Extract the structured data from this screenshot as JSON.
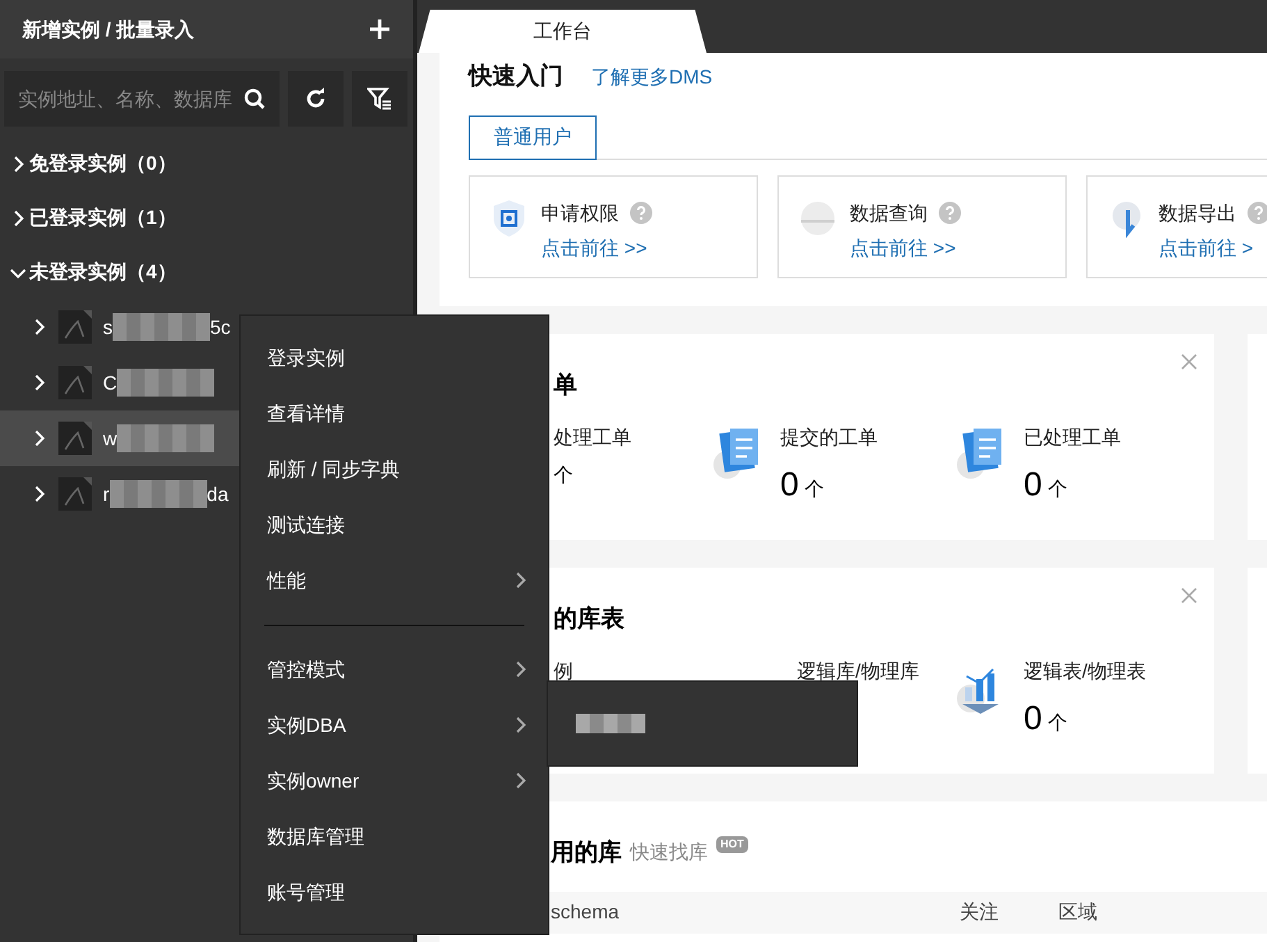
{
  "sidebar": {
    "title": "新增实例 / 批量录入",
    "search": {
      "placeholder": "实例地址、名称、数据库"
    },
    "groups": [
      {
        "label": "免登录实例（0）",
        "expanded": false
      },
      {
        "label": "已登录实例（1）",
        "expanded": false
      },
      {
        "label": "未登录实例（4）",
        "expanded": true,
        "items": [
          {
            "name_start": "s",
            "name_end": "5c",
            "selected": false
          },
          {
            "name_start": "C",
            "selected": false
          },
          {
            "name_start": "w",
            "selected": true
          },
          {
            "name_start": "r",
            "name_end": "da",
            "selected": false
          }
        ]
      }
    ]
  },
  "tabs": [
    {
      "label": "工作台",
      "selected": true
    }
  ],
  "quick_start": {
    "title": "快速入门",
    "link": "了解更多DMS",
    "role_tab": "普通用户",
    "entries": [
      {
        "label": "申请权限",
        "link": "点击前往 >>"
      },
      {
        "label": "数据查询",
        "link": "点击前往 >>"
      },
      {
        "label": "数据导出",
        "link": "点击前往 >"
      }
    ]
  },
  "cards": [
    {
      "title": "单",
      "stats": [
        {
          "label": "处理工单",
          "unit": "个",
          "icon": false
        },
        {
          "label": "提交的工单",
          "count": "0",
          "unit": "个",
          "icon": true
        },
        {
          "label": "已处理工单",
          "count": "0",
          "unit": "个",
          "icon": true
        }
      ]
    },
    {
      "title": "的库表",
      "stats": [
        {
          "label": "例",
          "icon": false
        },
        {
          "label": "逻辑库/物理库",
          "icon": false
        },
        {
          "label": "逻辑表/物理表",
          "count": "0",
          "unit": "个",
          "icon": true
        }
      ]
    }
  ],
  "frequent": {
    "title": "用的库",
    "subtitle": "快速找库",
    "badge": "HOT",
    "columns": [
      "schema",
      "关注",
      "区域"
    ]
  },
  "context_menu": {
    "items": [
      {
        "kind": "item",
        "label": "登录实例",
        "submenu": false
      },
      {
        "kind": "item",
        "label": "查看详情",
        "submenu": false
      },
      {
        "kind": "item",
        "label": "刷新 / 同步字典",
        "submenu": false
      },
      {
        "kind": "item",
        "label": "测试连接",
        "submenu": false
      },
      {
        "kind": "item",
        "label": "性能",
        "submenu": true
      },
      {
        "kind": "divider"
      },
      {
        "kind": "item",
        "label": "管控模式",
        "submenu": true
      },
      {
        "kind": "item",
        "label": "实例DBA",
        "submenu": true
      },
      {
        "kind": "item",
        "label": "实例owner",
        "submenu": true
      },
      {
        "kind": "item",
        "label": "数据库管理",
        "submenu": false
      },
      {
        "kind": "item",
        "label": "账号管理",
        "submenu": false
      }
    ]
  }
}
